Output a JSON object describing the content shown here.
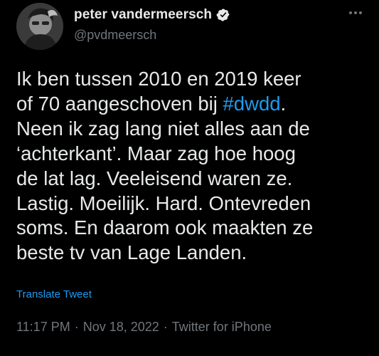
{
  "author": {
    "display_name": "peter vandermeersch",
    "handle": "@pvdmeersch",
    "verified": true,
    "avatar_icon": "profile-photo"
  },
  "tweet": {
    "lines": [
      "Ik ben tussen 2010 en 2019 keer",
      "of 70 aangeschoven bij ",
      "Neen ik zag lang niet alles aan de",
      "‘achterkant’. Maar zag hoe hoog",
      "de lat lag. Veeleisend waren ze.",
      "Lastig. Moeilijk. Hard. Ontevreden",
      "soms. En daarom ook maakten ze",
      "beste tv van Lage Landen."
    ],
    "hashtag": "#dwdd",
    "after_hashtag": "."
  },
  "translate_label": "Translate Tweet",
  "meta": {
    "time": "11:17 PM",
    "date": "Nov 18, 2022",
    "source": "Twitter for iPhone",
    "separator": "·"
  },
  "colors": {
    "background": "#000000",
    "text": "#e7e9ea",
    "secondary": "#71767b",
    "accent": "#1d9bf0"
  },
  "icons": {
    "verified": "verified-badge-icon",
    "more": "more-options-icon"
  }
}
